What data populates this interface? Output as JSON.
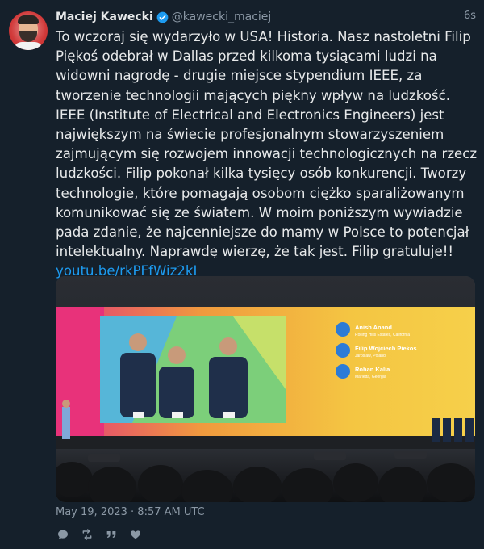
{
  "tweet": {
    "author_name": "Maciej Kawecki",
    "author_handle": "@kawecki_maciej",
    "relative_time": "6s",
    "text_parts": {
      "body": "To wczoraj się wydarzyło w USA! Historia. Nasz nastoletni Filip Piękoś odebrał w Dallas przed kilkoma tysiącami ludzi na widowni nagrodę - drugie miejsce stypendium IEEE, za tworzenie technologii mających piękny wpływ na ludzkość. IEEE (Institute of Electrical and Electronics Engineers) jest największym na świecie profesjonalnym stowarzyszeniem zajmującym się rozwojem innowacji technologicznych na rzecz ludzkości. Filip pokonał kilka tysięcy osób konkurencji. Tworzy technologie, które pomagają osobom ciężko sparaliżowanym komunikować się ze światem. W moim poniższym wywiadzie pada zdanie, że najcenniejsze do mamy w Polsce to potencjał intelektualny. Naprawdę wierzę, że tak jest. Filip gratuluje!! ",
      "link": "youtu.be/rkPFfWiz2kI"
    },
    "timestamp": "May 19, 2023 · 8:57 AM UTC",
    "media": {
      "screen_names": [
        {
          "name": "Anish Anand",
          "sub": "Rolling Hills Estates, California"
        },
        {
          "name": "Filip Wojciech Piekos",
          "sub": "Jaroslaw, Poland"
        },
        {
          "name": "Rohan Kalia",
          "sub": "Marietta, Georgia"
        }
      ]
    },
    "actions": {
      "reply": "reply-icon",
      "retweet": "retweet-icon",
      "quote": "quote-icon",
      "like": "heart-icon"
    },
    "colors": {
      "background": "#15202b",
      "link": "#1d9bf0",
      "muted": "#8b98a5",
      "verified": "#1d9bf0"
    }
  }
}
